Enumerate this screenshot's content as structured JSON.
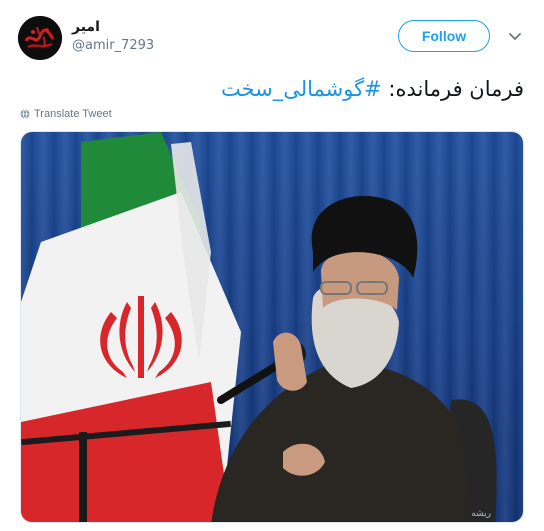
{
  "tweet": {
    "author": {
      "display_name": "امیر",
      "handle": "@amir_7293",
      "avatar_icon": "avatar-calligraphy-icon"
    },
    "follow_label": "Follow",
    "menu_icon": "chevron-down-icon",
    "text_prefix": "فرمان فرمانده: ",
    "hashtag": "#گوشمالی_سخت",
    "translate_label": "Translate Tweet",
    "translate_icon": "globe-icon",
    "media_watermark": "ریشه"
  },
  "colors": {
    "accent": "#1da1f2",
    "hashtag": "#1b95e0",
    "muted": "#657786",
    "text": "#14171a"
  }
}
